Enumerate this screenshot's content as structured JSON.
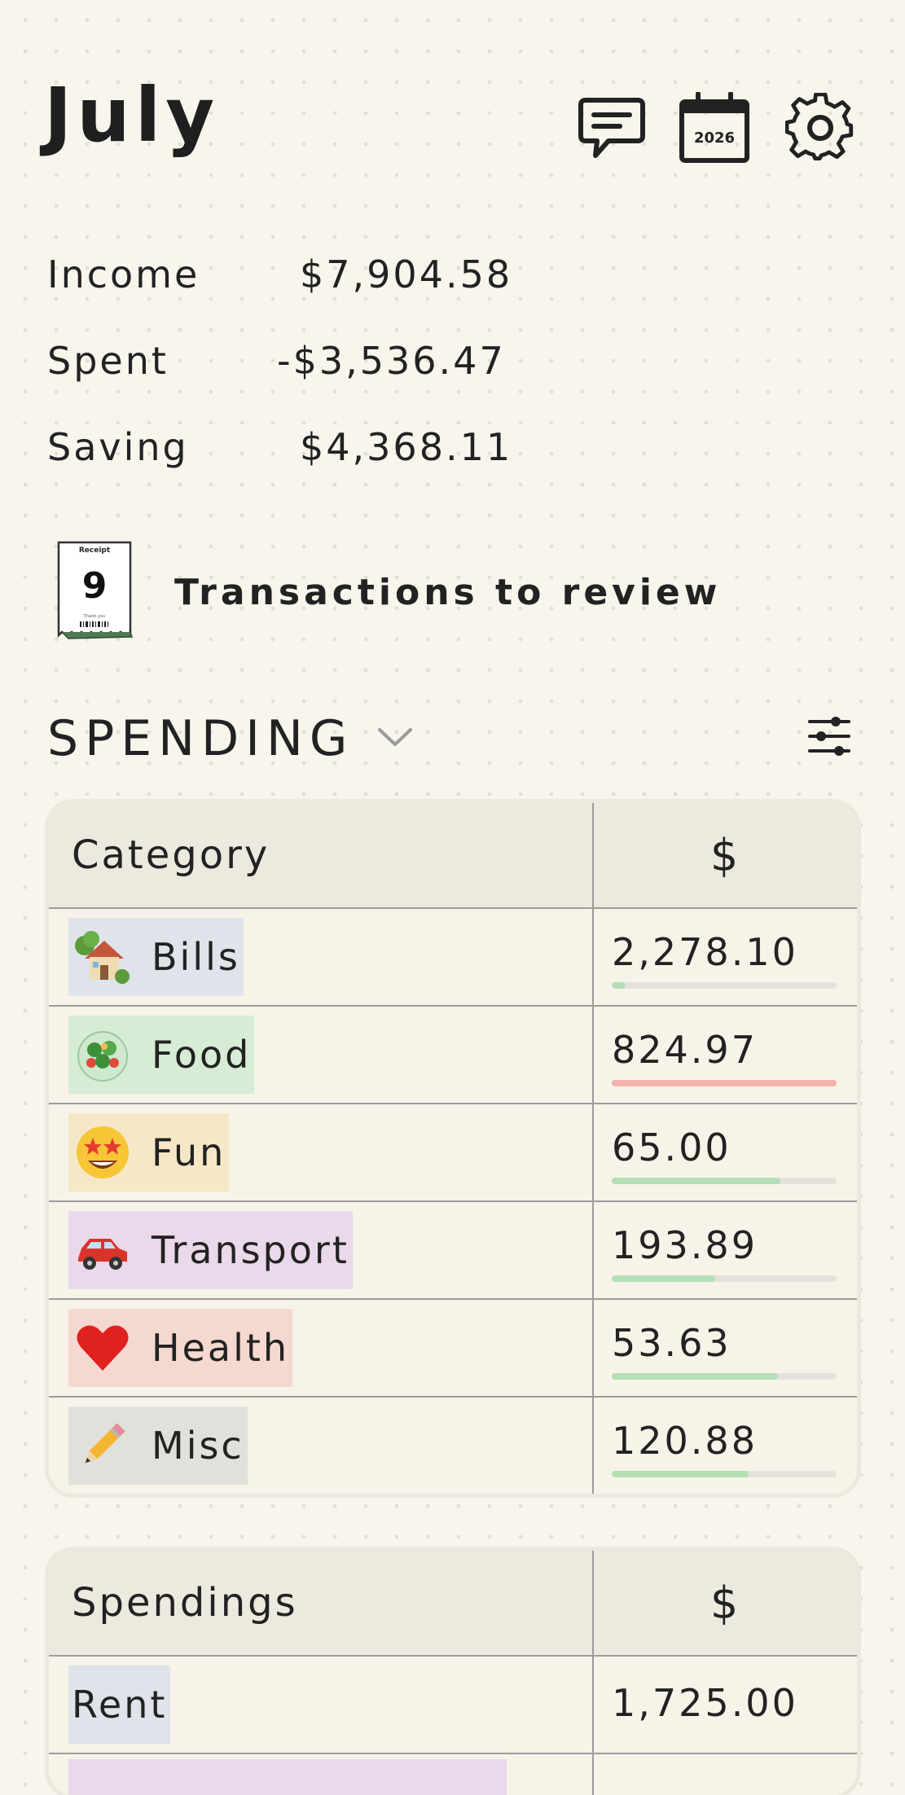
{
  "header": {
    "month": "July",
    "calendar_year": "2026",
    "icons": [
      "chat-icon",
      "calendar-icon",
      "gear-icon"
    ]
  },
  "summary": {
    "income_label": "Income",
    "income_value": "$7,904.58",
    "spent_label": "Spent",
    "spent_value": "-$3,536.47",
    "saving_label": "Saving",
    "saving_value": "$4,368.11"
  },
  "review": {
    "receipt_title": "Receipt",
    "receipt_count": "9",
    "receipt_footer": "Thank you",
    "label": "Transactions to review"
  },
  "spending_section": {
    "title": "SPENDING"
  },
  "category_table": {
    "col_category": "Category",
    "col_amount": "$",
    "rows": [
      {
        "emoji": "house-icon",
        "label": "Bills",
        "amount": "2,278.10",
        "bg": "#dfe3ea",
        "bar_fraction": 0.06,
        "bar_color": "#b4dfb5"
      },
      {
        "emoji": "salad-icon",
        "label": "Food",
        "amount": "824.97",
        "bg": "#d6ecd5",
        "bar_fraction": 1.0,
        "bar_color": "#f0b4ac"
      },
      {
        "emoji": "star-struck-icon",
        "label": "Fun",
        "amount": "65.00",
        "bg": "#f6e8c6",
        "bar_fraction": 0.75,
        "bar_color": "#b4dfb5"
      },
      {
        "emoji": "car-icon",
        "label": "Transport",
        "amount": "193.89",
        "bg": "#ead9ea",
        "bar_fraction": 0.46,
        "bar_color": "#b4dfb5"
      },
      {
        "emoji": "heart-icon",
        "label": "Health",
        "amount": "53.63",
        "bg": "#f5d8cf",
        "bar_fraction": 0.74,
        "bar_color": "#b4dfb5"
      },
      {
        "emoji": "pencil-icon",
        "label": "Misc",
        "amount": "120.88",
        "bg": "#e2e0da",
        "bar_fraction": 0.61,
        "bar_color": "#b4dfb5"
      }
    ]
  },
  "spendings_table": {
    "col_name": "Spendings",
    "col_amount": "$",
    "rows": [
      {
        "label": "Rent",
        "amount": "1,725.00",
        "bg": "#dfe3ea"
      },
      {
        "label": "",
        "amount": "",
        "bg": "#ead9ea"
      }
    ]
  }
}
